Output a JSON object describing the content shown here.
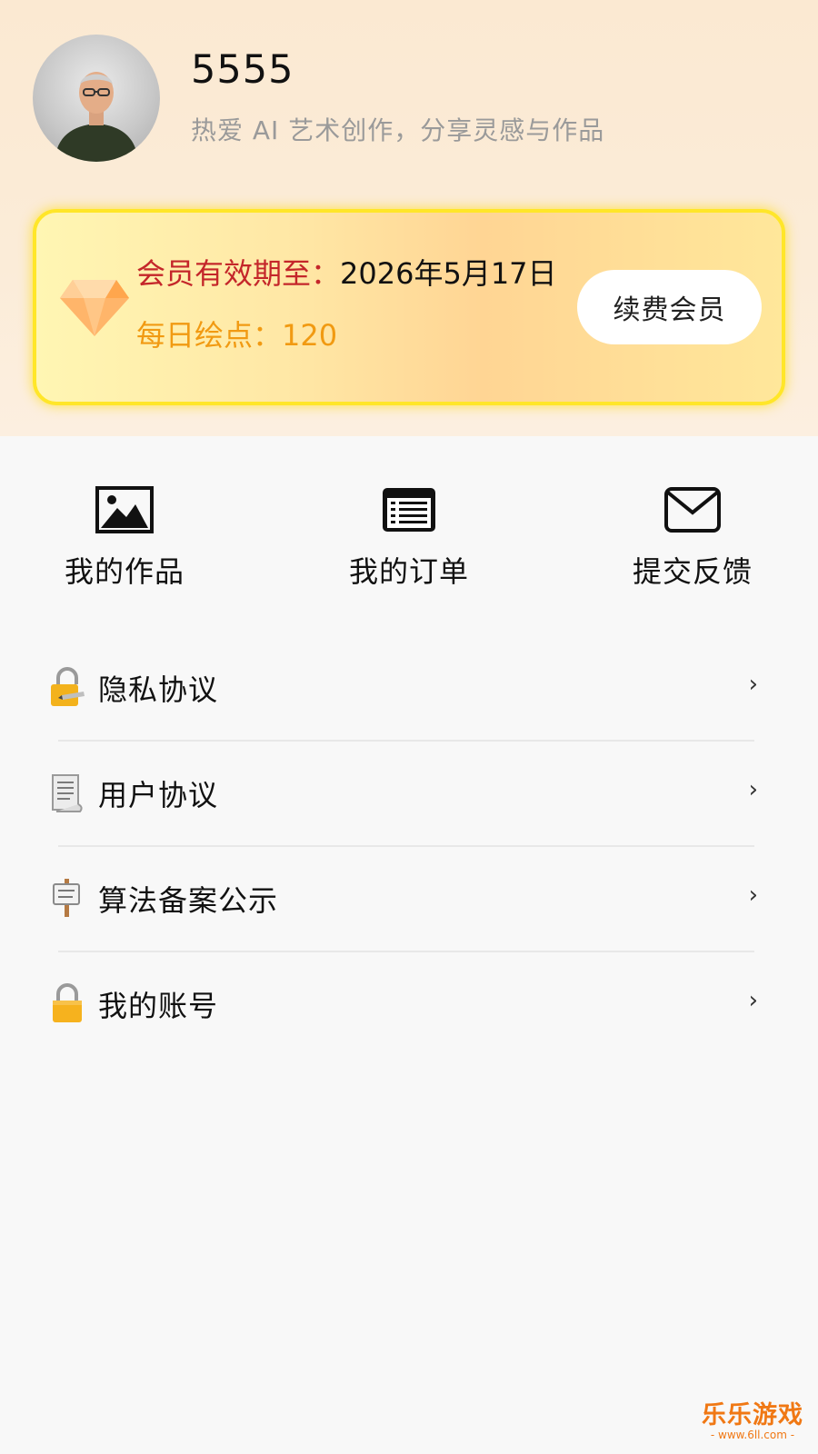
{
  "profile": {
    "username": "5555",
    "bio": "热爱 AI 艺术创作，分享灵感与作品"
  },
  "membership": {
    "expire_label": "会员有效期至：",
    "expire_date": "2026年5月17日",
    "points_label": "每日绘点：",
    "points_value": "120",
    "renew_label": "续费会员",
    "icon": "diamond-icon",
    "card_border_color": "#ffe629",
    "expire_label_color": "#c4262a",
    "points_color": "#f19a12"
  },
  "quick_actions": [
    {
      "label": "我的作品",
      "icon": "image-icon"
    },
    {
      "label": "我的订单",
      "icon": "list-icon"
    },
    {
      "label": "提交反馈",
      "icon": "mail-icon"
    }
  ],
  "menu": [
    {
      "label": "隐私协议",
      "icon": "lock-with-pen-icon"
    },
    {
      "label": "用户协议",
      "icon": "document-icon"
    },
    {
      "label": "算法备案公示",
      "icon": "signpost-icon"
    },
    {
      "label": "我的账号",
      "icon": "lock-icon"
    }
  ],
  "chevron": "›",
  "watermark": {
    "text": "乐乐游戏",
    "url": "- www.6ll.com -"
  }
}
